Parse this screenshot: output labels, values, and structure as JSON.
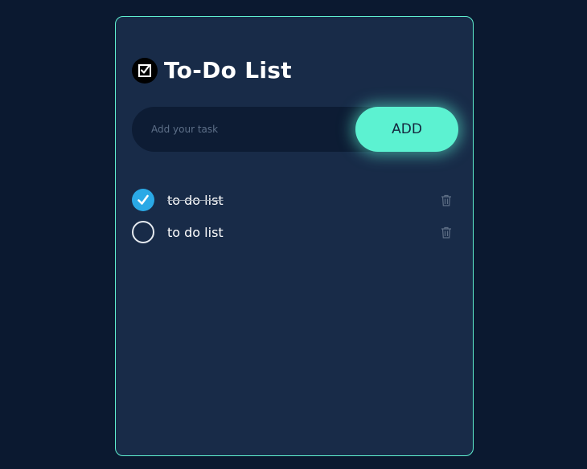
{
  "app": {
    "title": "To-Do List",
    "title_icon": "checkbox-icon"
  },
  "input": {
    "placeholder": "Add your task",
    "value": ""
  },
  "add_button": {
    "label": "ADD"
  },
  "todos": [
    {
      "text": "to do list",
      "completed": true
    },
    {
      "text": "to do list",
      "completed": false
    }
  ],
  "colors": {
    "background": "#0b1930",
    "card": "#182b48",
    "accent": "#5cf2d1",
    "check": "#2aa9e6"
  },
  "icons": {
    "delete": "trash-icon",
    "checked": "check-circle-icon",
    "unchecked": "empty-circle-icon"
  }
}
